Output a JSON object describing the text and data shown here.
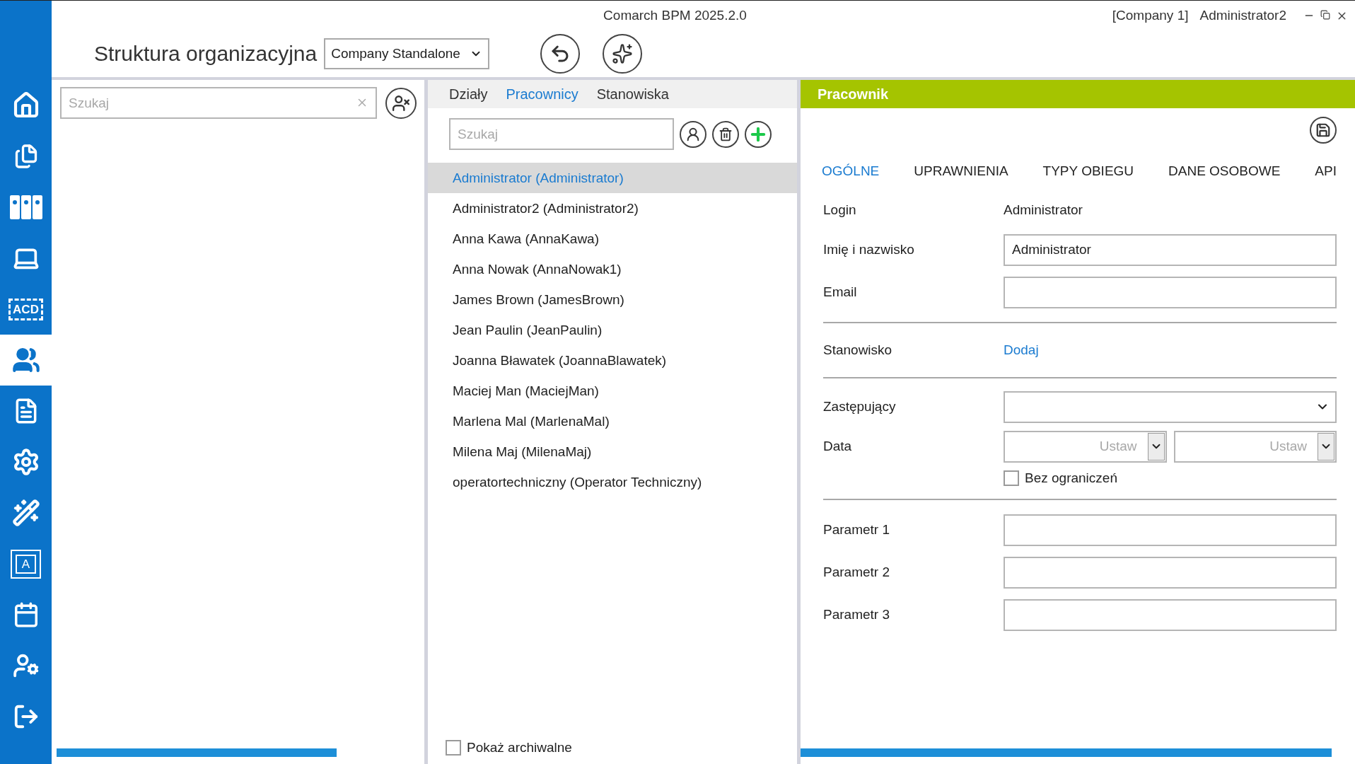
{
  "window": {
    "app_title": "Comarch BPM 2025.2.0",
    "company": "[Company 1]",
    "user": "Administrator2"
  },
  "sidebar": {
    "items": [
      {
        "selected": false
      },
      {
        "selected": false
      },
      {
        "selected": false
      },
      {
        "selected": false
      },
      {
        "selected": false,
        "text": "ACD"
      },
      {
        "selected": true
      },
      {
        "selected": false
      },
      {
        "selected": false
      },
      {
        "selected": false
      },
      {
        "selected": false,
        "text": "A"
      },
      {
        "selected": false
      },
      {
        "selected": false
      },
      {
        "selected": false
      }
    ]
  },
  "header": {
    "title": "Struktura organizacyjna",
    "company_select": {
      "value": "Company Standalone"
    }
  },
  "left_panel": {
    "search": {
      "placeholder": "Szukaj"
    }
  },
  "middle_panel": {
    "tabs": [
      {
        "label": "Działy",
        "selected": false
      },
      {
        "label": "Pracownicy",
        "selected": true
      },
      {
        "label": "Stanowiska",
        "selected": false
      }
    ],
    "search": {
      "placeholder": "Szukaj"
    },
    "employees": [
      {
        "name": "Administrator (Administrator)",
        "selected": true
      },
      {
        "name": "Administrator2 (Administrator2)",
        "selected": false
      },
      {
        "name": "Anna Kawa (AnnaKawa)",
        "selected": false
      },
      {
        "name": "Anna Nowak (AnnaNowak1)",
        "selected": false
      },
      {
        "name": "James Brown (JamesBrown)",
        "selected": false
      },
      {
        "name": "Jean Paulin (JeanPaulin)",
        "selected": false
      },
      {
        "name": "Joanna Bławatek (JoannaBlawatek)",
        "selected": false
      },
      {
        "name": "Maciej Man (MaciejMan)",
        "selected": false
      },
      {
        "name": "Marlena Mal (MarlenaMal)",
        "selected": false
      },
      {
        "name": "Milena Maj (MilenaMaj)",
        "selected": false
      },
      {
        "name": "operatortechniczny (Operator Techniczny)",
        "selected": false
      }
    ],
    "show_archived": {
      "label": "Pokaż archiwalne",
      "checked": false
    }
  },
  "right_panel": {
    "title": "Pracownik",
    "tabs": [
      {
        "label": "OGÓLNE",
        "selected": true
      },
      {
        "label": "UPRAWNIENIA",
        "selected": false
      },
      {
        "label": "TYPY OBIEGU",
        "selected": false
      },
      {
        "label": "DANE OSOBOWE",
        "selected": false
      },
      {
        "label": "API",
        "selected": false
      }
    ],
    "form": [
      {
        "kind": "static",
        "label": "Login",
        "value": "Administrator"
      },
      {
        "kind": "input",
        "label": "Imię i nazwisko",
        "value": "Administrator"
      },
      {
        "kind": "input",
        "label": "Email"
      },
      {
        "kind": "rule"
      },
      {
        "kind": "link",
        "label": "Stanowisko",
        "link": "Dodaj"
      },
      {
        "kind": "rule"
      },
      {
        "kind": "select",
        "label": "Zastępujący"
      },
      {
        "kind": "dates",
        "label": "Data",
        "from": {
          "placeholder": "Ustaw"
        },
        "to": {
          "placeholder": "Ustaw"
        },
        "no_limit": {
          "label": "Bez ograniczeń",
          "checked": false
        }
      },
      {
        "kind": "rule"
      },
      {
        "kind": "input",
        "label": "Parametr 1"
      },
      {
        "kind": "input",
        "label": "Parametr 2"
      },
      {
        "kind": "input",
        "label": "Parametr 3"
      }
    ]
  }
}
